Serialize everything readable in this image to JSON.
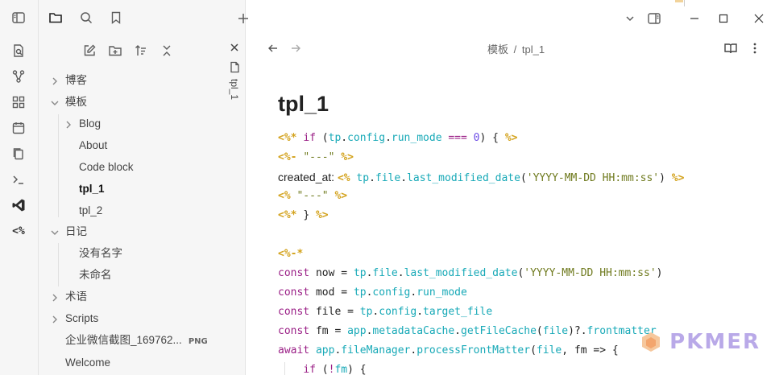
{
  "ribbon": {
    "icons": [
      "sidebar-toggle-icon",
      "quick-switcher-icon",
      "graph-view-icon",
      "canvas-icon",
      "daily-note-icon",
      "templates-icon",
      "command-palette-icon",
      "vscode-icon",
      "templater-icon"
    ],
    "templater_label": "<%"
  },
  "sidebar": {
    "tree": [
      {
        "label": "博客",
        "kind": "folder",
        "expanded": false
      },
      {
        "label": "模板",
        "kind": "folder",
        "expanded": true
      },
      {
        "label": "Blog",
        "kind": "folder",
        "expanded": false
      },
      {
        "label": "About",
        "kind": "file"
      },
      {
        "label": "Code block",
        "kind": "file"
      },
      {
        "label": "tpl_1",
        "kind": "file",
        "active": true
      },
      {
        "label": "tpl_2",
        "kind": "file"
      },
      {
        "label": "日记",
        "kind": "folder",
        "expanded": true
      },
      {
        "label": "没有名字",
        "kind": "file"
      },
      {
        "label": "未命名",
        "kind": "file"
      },
      {
        "label": "术语",
        "kind": "folder",
        "expanded": false
      },
      {
        "label": "Scripts",
        "kind": "folder",
        "expanded": false
      },
      {
        "label": "企业微信截图_169762...",
        "kind": "file",
        "badge": "PNG"
      },
      {
        "label": "Welcome",
        "kind": "file"
      }
    ]
  },
  "tab": {
    "vertical_label": "tpl_1"
  },
  "editor": {
    "breadcrumb_folder": "模板",
    "breadcrumb_sep": "/",
    "breadcrumb_file": "tpl_1",
    "title": "tpl_1"
  },
  "watermark": {
    "text": "PKMER"
  },
  "colors": {
    "tag": "#d3a21c",
    "keyword": "#9a1f86",
    "object": "#17a9b7",
    "string": "#6f7a1e",
    "number": "#6c4ce6"
  }
}
